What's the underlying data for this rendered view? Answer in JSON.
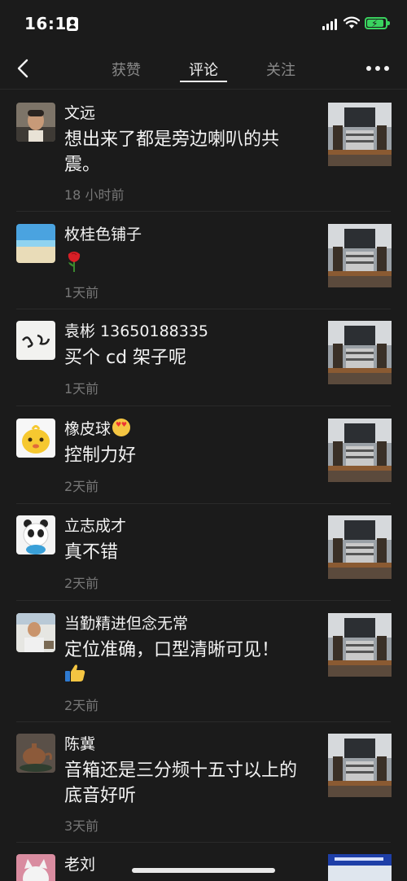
{
  "status_bar": {
    "time": "16:19"
  },
  "nav": {
    "tabs": [
      {
        "label": "获赞",
        "active": false
      },
      {
        "label": "评论",
        "active": true
      },
      {
        "label": "关注",
        "active": false
      }
    ]
  },
  "comments": [
    {
      "name": "文远",
      "text": "想出来了都是旁边喇叭的共震。",
      "time": "18 小时前"
    },
    {
      "name": "枚桂色铺子",
      "text": "",
      "time": "1天前",
      "emoji": "rose"
    },
    {
      "name": "袁彬 13650188335",
      "text": "买个 cd 架子呢",
      "time": "1天前"
    },
    {
      "name": "橡皮球",
      "text": "控制力好",
      "time": "2天前",
      "name_emoji": "heart-eyes"
    },
    {
      "name": "立志成才",
      "text": "真不错",
      "time": "2天前"
    },
    {
      "name": "当勤精进但念无常",
      "text": "定位准确，口型清晰可见！",
      "time": "2天前",
      "emoji": "thumbs-up"
    },
    {
      "name": "陈冀",
      "text": "音箱还是三分频十五寸以上的底音好听",
      "time": "3天前"
    },
    {
      "name": "老刘",
      "text": "",
      "time": ""
    }
  ],
  "colors": {
    "background": "#1b1b1b",
    "secondary_text": "#777777",
    "tab_inactive": "#8a8a8a",
    "battery": "#3ad35f"
  }
}
